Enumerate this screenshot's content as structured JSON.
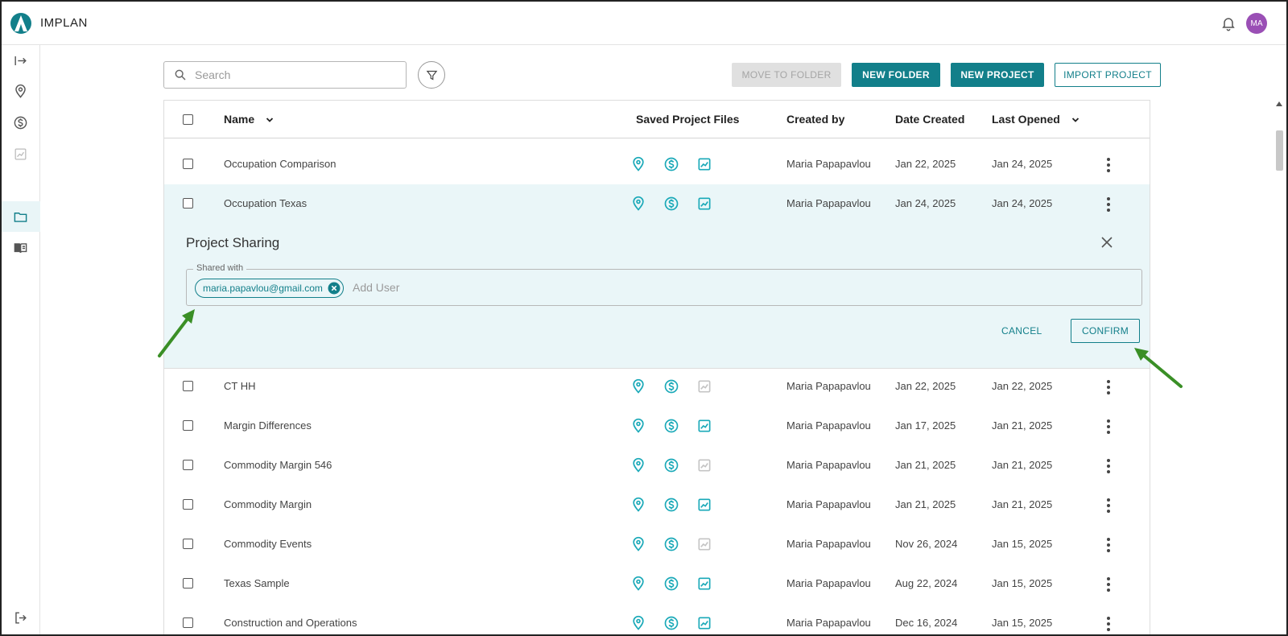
{
  "app": {
    "brand": "IMPLAN",
    "user_initials": "MA"
  },
  "colors": {
    "accent": "#127f8a",
    "icon_active": "#1aa9b8",
    "icon_inactive": "#c4c4c4",
    "highlight_row": "#eaf6f8",
    "annotation_arrow": "#3a8f26"
  },
  "sidebar": {
    "items": [
      {
        "name": "expand-icon"
      },
      {
        "name": "location-pin-icon"
      },
      {
        "name": "dollar-icon"
      },
      {
        "name": "chart-icon"
      },
      {
        "name": "folder-icon",
        "active": true
      },
      {
        "name": "book-icon"
      },
      {
        "name": "logout-icon"
      }
    ]
  },
  "toolbar": {
    "search_placeholder": "Search",
    "move_to_folder": "MOVE TO FOLDER",
    "new_folder": "NEW FOLDER",
    "new_project": "NEW PROJECT",
    "import_project": "IMPORT PROJECT"
  },
  "table": {
    "headers": {
      "name": "Name",
      "saved_files": "Saved Project Files",
      "created_by": "Created by",
      "date_created": "Date Created",
      "last_opened": "Last Opened"
    },
    "rows": [
      {
        "name": "Occupation Comparison",
        "created_by": "Maria Papapavlou",
        "date_created": "Jan 22, 2025",
        "last_opened": "Jan 24, 2025",
        "files": {
          "region": true,
          "impacts": true,
          "results": true
        }
      },
      {
        "name": "Occupation Texas",
        "created_by": "Maria Papapavlou",
        "date_created": "Jan 24, 2025",
        "last_opened": "Jan 24, 2025",
        "files": {
          "region": true,
          "impacts": true,
          "results": true
        }
      },
      {
        "name": "CT HH",
        "created_by": "Maria Papapavlou",
        "date_created": "Jan 22, 2025",
        "last_opened": "Jan 22, 2025",
        "files": {
          "region": true,
          "impacts": true,
          "results": false
        }
      },
      {
        "name": "Margin Differences",
        "created_by": "Maria Papapavlou",
        "date_created": "Jan 17, 2025",
        "last_opened": "Jan 21, 2025",
        "files": {
          "region": true,
          "impacts": true,
          "results": true
        }
      },
      {
        "name": "Commodity Margin 546",
        "created_by": "Maria Papapavlou",
        "date_created": "Jan 21, 2025",
        "last_opened": "Jan 21, 2025",
        "files": {
          "region": true,
          "impacts": true,
          "results": false
        }
      },
      {
        "name": "Commodity Margin",
        "created_by": "Maria Papapavlou",
        "date_created": "Jan 21, 2025",
        "last_opened": "Jan 21, 2025",
        "files": {
          "region": true,
          "impacts": true,
          "results": true
        }
      },
      {
        "name": "Commodity Events",
        "created_by": "Maria Papapavlou",
        "date_created": "Nov 26, 2024",
        "last_opened": "Jan 15, 2025",
        "files": {
          "region": true,
          "impacts": true,
          "results": false
        }
      },
      {
        "name": "Texas Sample",
        "created_by": "Maria Papapavlou",
        "date_created": "Aug 22, 2024",
        "last_opened": "Jan 15, 2025",
        "files": {
          "region": true,
          "impacts": true,
          "results": true
        }
      },
      {
        "name": "Construction and Operations",
        "created_by": "Maria Papapavlou",
        "date_created": "Dec 16, 2024",
        "last_opened": "Jan 15, 2025",
        "files": {
          "region": true,
          "impacts": true,
          "results": true
        }
      }
    ]
  },
  "sharing": {
    "title": "Project Sharing",
    "field_label": "Shared with",
    "shared_users": [
      "maria.papavlou@gmail.com"
    ],
    "add_placeholder": "Add User",
    "cancel": "CANCEL",
    "confirm": "CONFIRM"
  }
}
